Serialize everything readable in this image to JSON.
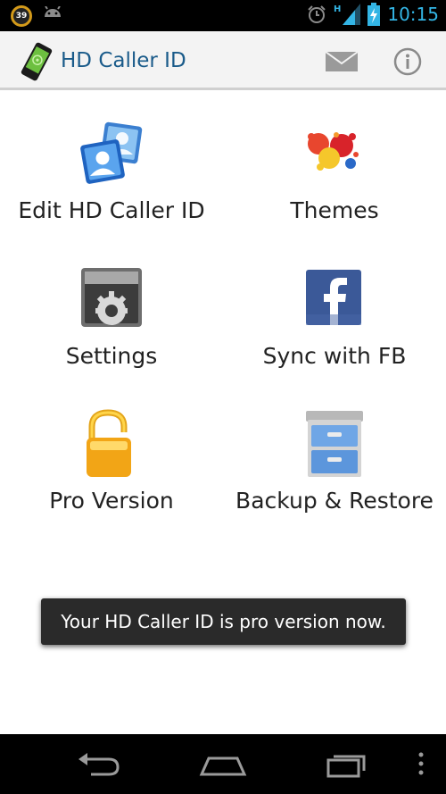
{
  "status_bar": {
    "notification_badge": "39",
    "time": "10:15",
    "network_type": "H",
    "icons": [
      "notification-count-icon",
      "android-icon",
      "alarm-icon",
      "signal-icon",
      "battery-charging-icon"
    ]
  },
  "action_bar": {
    "title": "HD Caller ID",
    "logo_icon": "phone-logo-icon",
    "mail_icon": "mail-icon",
    "info_icon": "info-icon"
  },
  "menu": {
    "items": [
      {
        "label": "Edit HD Caller ID",
        "icon": "contacts-icon"
      },
      {
        "label": "Themes",
        "icon": "paint-splash-icon"
      },
      {
        "label": "Settings",
        "icon": "gear-icon"
      },
      {
        "label": "Sync with FB",
        "icon": "facebook-icon"
      },
      {
        "label": "Pro Version",
        "icon": "unlocked-padlock-icon"
      },
      {
        "label": "Backup & Restore",
        "icon": "file-cabinet-icon"
      }
    ]
  },
  "toast": {
    "message": "Your HD Caller ID is pro version now."
  },
  "nav_bar": {
    "icons": [
      "back-icon",
      "home-icon",
      "recent-apps-icon",
      "overflow-menu-icon"
    ]
  },
  "colors": {
    "accent": "#33b5e5",
    "title": "#1a5b8a",
    "action_bar_bg": "#f3f3f3"
  }
}
